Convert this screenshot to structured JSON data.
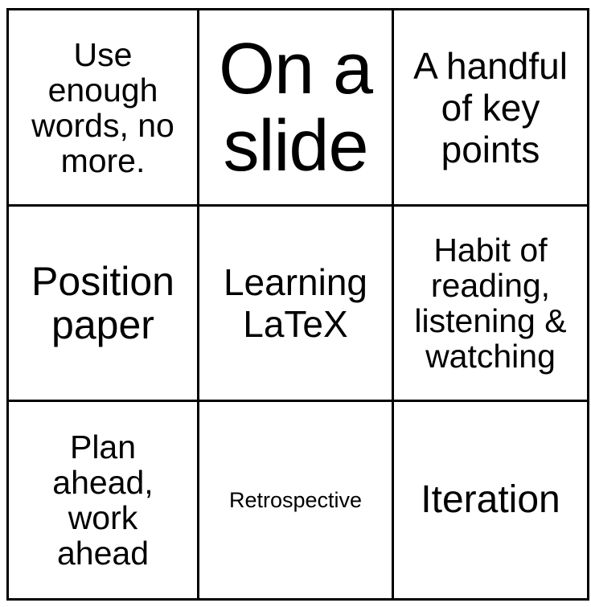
{
  "cells": [
    {
      "text": "Use\nenough\nwords, no\nmore."
    },
    {
      "text": "On a\nslide"
    },
    {
      "text": "A handful\nof key\npoints"
    },
    {
      "text": "Position\npaper"
    },
    {
      "text": "Learning\nLaTeX"
    },
    {
      "text": "Habit of\nreading,\nlistening &\nwatching"
    },
    {
      "text": "Plan\nahead,\nwork\nahead"
    },
    {
      "text": "Retrospective"
    },
    {
      "text": "Iteration"
    }
  ]
}
